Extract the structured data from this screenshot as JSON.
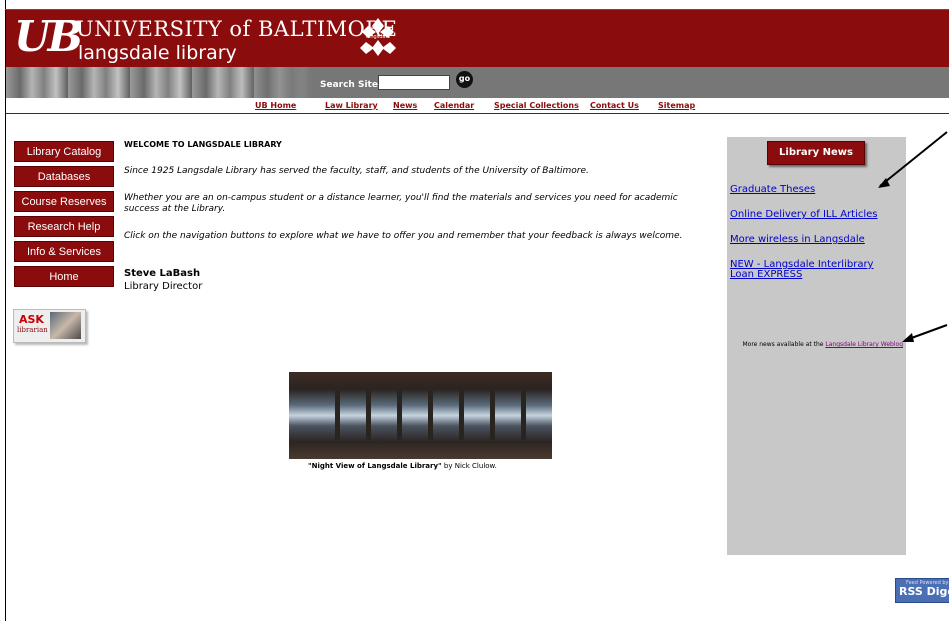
{
  "header": {
    "logo_ub": "UB",
    "university": "UNIVERSITY of BALTIMORE",
    "library": "langsdale library",
    "emblem_text": "langsdale"
  },
  "search": {
    "label": "Search Site",
    "value": "",
    "go_label": "go"
  },
  "nav": [
    {
      "label": "UB Home"
    },
    {
      "label": "Law Library"
    },
    {
      "label": "News"
    },
    {
      "label": "Calendar"
    },
    {
      "label": "Special Collections"
    },
    {
      "label": "Contact Us"
    },
    {
      "label": "Sitemap"
    }
  ],
  "sidebar": {
    "items": [
      {
        "label": "Library Catalog"
      },
      {
        "label": "Databases"
      },
      {
        "label": "Course Reserves"
      },
      {
        "label": "Research Help"
      },
      {
        "label": "Info & Services"
      },
      {
        "label": "Home"
      }
    ],
    "ask_title": "ASK",
    "ask_sub": "librarian"
  },
  "main": {
    "welcome": "WELCOME TO LANGSDALE LIBRARY",
    "paragraphs": [
      "Since 1925 Langsdale Library has served the faculty, staff, and students of the University of Baltimore.",
      "Whether you are an on-campus student or a distance learner, you'll find the materials and services you need for academic success at the Library.",
      "Click on the navigation buttons to explore what we have to offer you and remember that your feedback is always welcome."
    ],
    "signature_name": "Steve LaBash",
    "signature_title": "Library Director",
    "caption_title": "\"Night View of Langsdale Library\"",
    "caption_by": " by Nick Clulow."
  },
  "news": {
    "button": "Library News",
    "links": [
      {
        "label": "Graduate Theses"
      },
      {
        "label": "Online Delivery of ILL Articles"
      },
      {
        "label": "More wireless in Langsdale"
      },
      {
        "label": "NEW - Langsdale Interlibrary Loan EXPRESS"
      }
    ],
    "more_prefix": "More news available at the ",
    "more_link": "Langsdale Library Weblog"
  },
  "rss": {
    "small": "Feed Powered by",
    "big": "RSS Digest"
  },
  "colors": {
    "brand": "#8b0c0c",
    "link": "#0000cc",
    "visited": "#800080",
    "panel": "#c8c8c8"
  }
}
